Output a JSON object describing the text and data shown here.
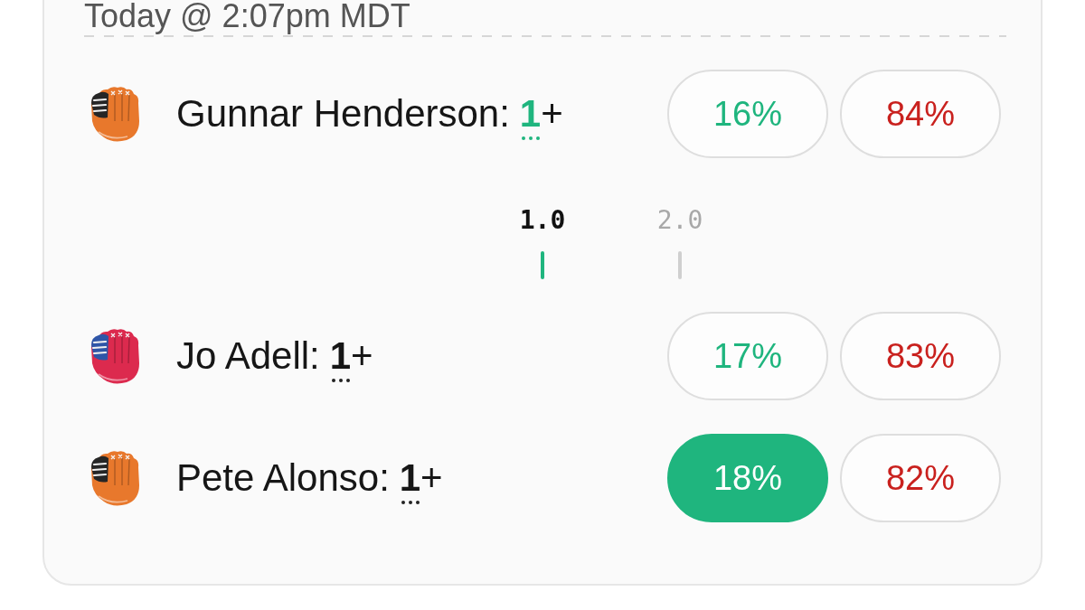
{
  "timestamp": "Today @ 2:07pm MDT",
  "rows": [
    {
      "kind": "player",
      "name": "Gunnar Henderson:",
      "line": "1",
      "suffix": "+",
      "line_highlighted": true,
      "color": "#e8782c",
      "web": {
        "color": "#262626"
      },
      "options": [
        {
          "kind": "yes",
          "label": "16%",
          "selected": false
        },
        {
          "kind": "no",
          "label": "84%",
          "selected": false
        }
      ]
    },
    {
      "kind": "line_picker",
      "options": [
        {
          "label": "1.0",
          "selected": true
        },
        {
          "label": "2.0",
          "selected": false
        }
      ]
    },
    {
      "kind": "player",
      "name": "Jo Adell:",
      "line": "1",
      "suffix": "+",
      "line_highlighted": false,
      "color": "#dc2a4e",
      "web": {
        "color": "#2f56a8"
      },
      "options": [
        {
          "kind": "yes",
          "label": "17%",
          "selected": false
        },
        {
          "kind": "no",
          "label": "83%",
          "selected": false
        }
      ]
    },
    {
      "kind": "player",
      "name": "Pete Alonso:",
      "line": "1",
      "suffix": "+",
      "line_highlighted": false,
      "color": "#e8782c",
      "web": {
        "color": "#262626"
      },
      "options": [
        {
          "kind": "yes",
          "label": "18%",
          "selected": true
        },
        {
          "kind": "no",
          "label": "82%",
          "selected": false
        }
      ]
    }
  ]
}
